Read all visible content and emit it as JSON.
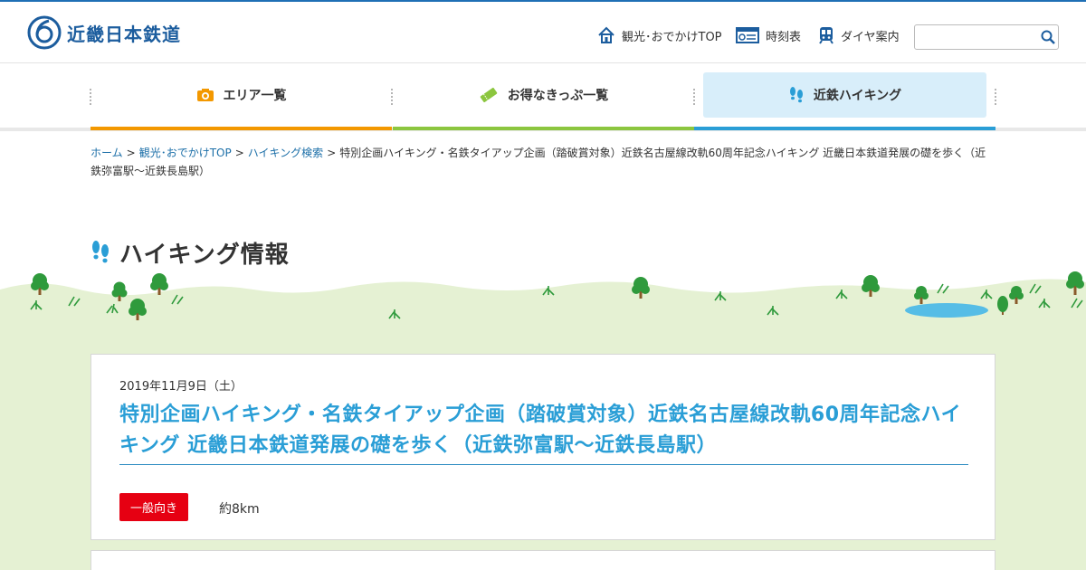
{
  "site": {
    "logo_text": "近畿日本鉄道",
    "brand_color": "#1c5d9e"
  },
  "header_nav": [
    {
      "label": "観光･おでかけTOP",
      "icon": "house-icon"
    },
    {
      "label": "時刻表",
      "icon": "timetable-icon"
    },
    {
      "label": "ダイヤ案内",
      "icon": "train-icon"
    }
  ],
  "search": {
    "placeholder": "",
    "value": ""
  },
  "main_nav": [
    {
      "label": "エリア一覧",
      "icon": "camera-icon",
      "accent": "#f39800",
      "active": false
    },
    {
      "label": "お得なきっぷ一覧",
      "icon": "ticket-icon",
      "accent": "#8cc63f",
      "active": false
    },
    {
      "label": "近鉄ハイキング",
      "icon": "footprints-icon",
      "accent": "#2a9ed6",
      "active": true
    }
  ],
  "breadcrumb": {
    "links": [
      "ホーム",
      "観光･おでかけTOP",
      "ハイキング検索"
    ],
    "current": "特別企画ハイキング・名鉄タイアップ企画（踏破賞対象）近鉄名古屋線改軌60周年記念ハイキング 近畿日本鉄道発展の礎を歩く（近鉄弥富駅～近鉄長島駅）"
  },
  "page_title": "ハイキング情報",
  "event": {
    "date": "2019年11月9日（土）",
    "title": "特別企画ハイキング・名鉄タイアップ企画（踏破賞対象）近鉄名古屋線改軌60周年記念ハイキング 近畿日本鉄道発展の礎を歩く（近鉄弥富駅～近鉄長島駅）",
    "level": "一般向き",
    "distance": "約8km",
    "title_color": "#2a9ed6",
    "level_color": "#e60012"
  }
}
